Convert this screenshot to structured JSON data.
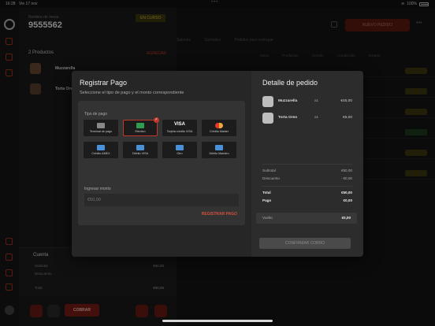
{
  "status_bar": {
    "time": "16:28",
    "date": "Vie 17 nov",
    "battery": "100%"
  },
  "order": {
    "table_label": "Nombre de mesa",
    "table_number": "9555562",
    "state_badge": "EN CURSO",
    "products_count": "2 Productos",
    "add_link": "AGREGAR",
    "products": [
      {
        "name": "Muzzarella"
      },
      {
        "name": "Torta Oreo"
      }
    ],
    "account": {
      "title": "Cuenta",
      "subtotal_label": "Subtotal",
      "subtotal_value": "€50,00",
      "discount_label": "Descuento",
      "total_label": "Total",
      "total_value": "€50,00"
    },
    "cobrar_label": "COBRAR"
  },
  "main": {
    "new_order_label": "NUEVO PEDIDO",
    "tabs": [
      "Salones",
      "Cerrados",
      "Pedidos para entregar"
    ],
    "columns": [
      "Mesa",
      "Productos",
      "Creado",
      "Actualizado",
      "Estado"
    ],
    "row_colors": [
      "#3f3a12",
      "#3f3a12",
      "#3f3a12",
      "#1e3d1e",
      "#3f3a12",
      "#3f3a12"
    ]
  },
  "modal": {
    "title": "Registrar Pago",
    "subtitle": "Seleccione el tipo de pago y el monto correspondiente",
    "payment_type_label": "Tipo de pago",
    "payment_methods": [
      {
        "label": "Terminal de pago",
        "icon": "pos-terminal-icon",
        "color": "#888888"
      },
      {
        "label": "Efectivo",
        "icon": "cash-icon",
        "color": "#2e9d4f",
        "selected": true
      },
      {
        "label": "Tarjeta crédito VISA",
        "icon": "visa-icon",
        "color": "#ffffff"
      },
      {
        "label": "Crédito Master",
        "icon": "mastercard-icon",
        "color": "#e8a33c"
      },
      {
        "label": "Crédito AMEX",
        "icon": "amex-icon",
        "color": "#4a90d9"
      },
      {
        "label": "Débito VISA",
        "icon": "debit-visa-icon",
        "color": "#4a90d9"
      },
      {
        "label": "Otro",
        "icon": "other-card-icon",
        "color": "#4a90d9"
      },
      {
        "label": "Débito Maestro",
        "icon": "maestro-icon",
        "color": "#4a90d9"
      }
    ],
    "amount_label": "Ingresar monto",
    "amount_placeholder": "€50,00",
    "register_label": "REGISTRAR PAGO",
    "detail": {
      "title": "Detalle de pedido",
      "items": [
        {
          "name": "Muzzarella",
          "qty": "x1",
          "price": "€45,00"
        },
        {
          "name": "Torta Oreo",
          "qty": "x1",
          "price": "€5,00"
        }
      ],
      "subtotal_label": "Subtotal",
      "subtotal_value": "€50,00",
      "discount_label": "Descuento",
      "discount_value": "- €0,00",
      "total_label": "Total",
      "total_value": "€50,00",
      "paid_label": "Pago",
      "paid_value": "€0,00",
      "change_label": "Vuelto",
      "change_value": "€0,00",
      "confirm_label": "CONFIRMAR COBRO"
    }
  }
}
